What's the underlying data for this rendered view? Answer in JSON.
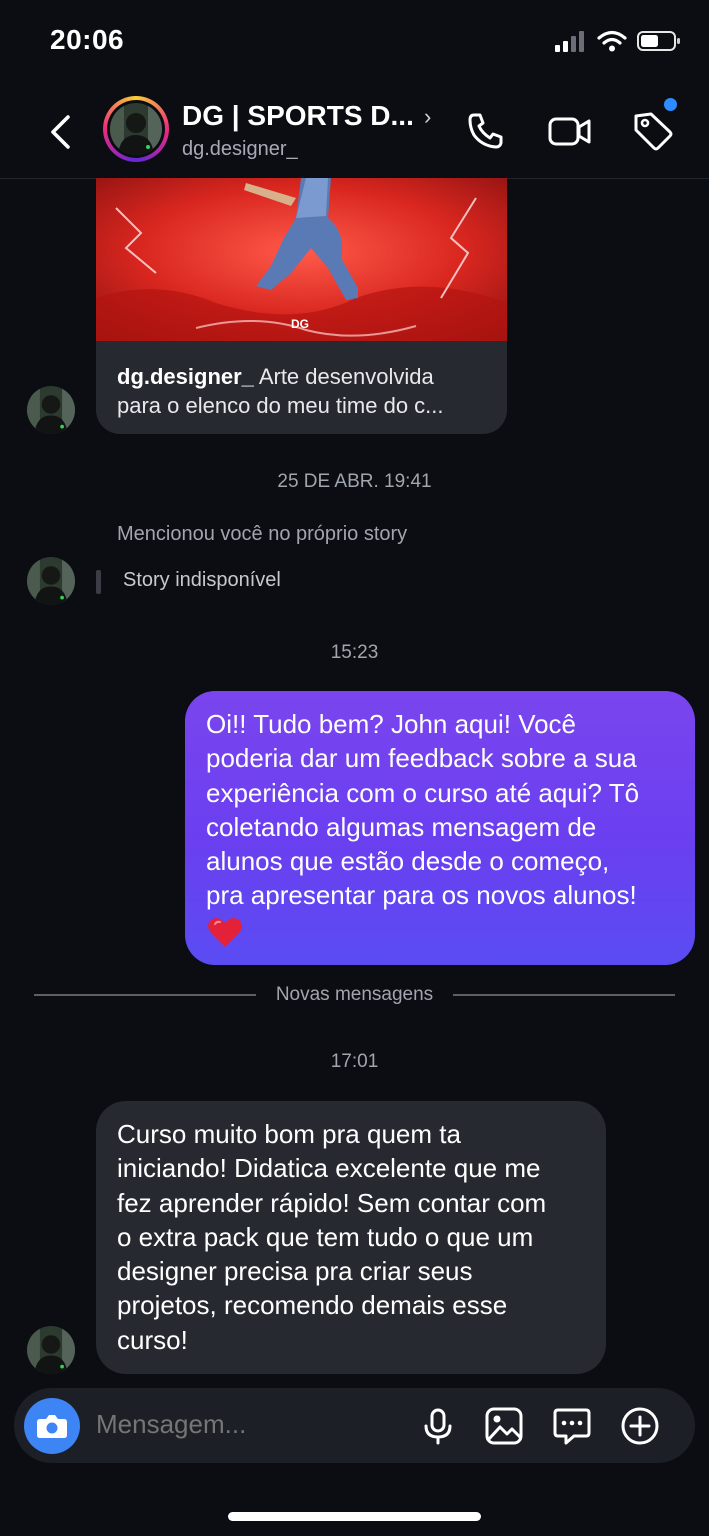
{
  "status_bar": {
    "time": "20:06"
  },
  "header": {
    "title": "DG | SPORTS D...",
    "username": "dg.designer_",
    "chevron": "›"
  },
  "shared_post": {
    "author": "dg.designer_",
    "caption_line1": " Arte desenvolvida",
    "caption_line2": "para o elenco do meu time do c...",
    "logo": "DG"
  },
  "timestamps": {
    "story": "25 DE ABR. 19:41",
    "outgoing": "15:23",
    "incoming": "17:01"
  },
  "story_mention": {
    "label": "Mencionou você no próprio story",
    "status": "Story indisponível"
  },
  "outgoing_message": {
    "lines": [
      "Oi!! Tudo bem? John aqui! Você",
      "poderia dar um feedback sobre a sua",
      "experiência com o curso até aqui? Tô",
      "coletando algumas mensagem de",
      "alunos que estão desde o começo,",
      "pra apresentar para os novos alunos!"
    ],
    "emoji": "heart"
  },
  "divider": {
    "label": "Novas mensagens"
  },
  "incoming_message": {
    "lines": [
      "Curso muito bom pra quem ta",
      "iniciando! Didatica excelente que me",
      "fez aprender rápido! Sem contar com",
      "o extra pack que tem tudo o que um",
      "designer precisa pra criar seus",
      "projetos, recomendo demais esse",
      "curso!"
    ]
  },
  "composer": {
    "placeholder": "Mensagem..."
  },
  "colors": {
    "background": "#0b0d13",
    "outgoing_bubble": "#6a3ff0",
    "incoming_bubble": "#26292f",
    "camera_button": "#3d84f4",
    "notification_dot": "#2d8cff"
  },
  "icons": {
    "back": "chevron-left-icon",
    "call": "phone-icon",
    "video": "video-camera-icon",
    "tag": "tag-icon",
    "camera": "camera-icon",
    "mic": "microphone-icon",
    "gallery": "image-icon",
    "sticker": "chat-sticker-icon",
    "plus": "plus-circle-icon"
  }
}
